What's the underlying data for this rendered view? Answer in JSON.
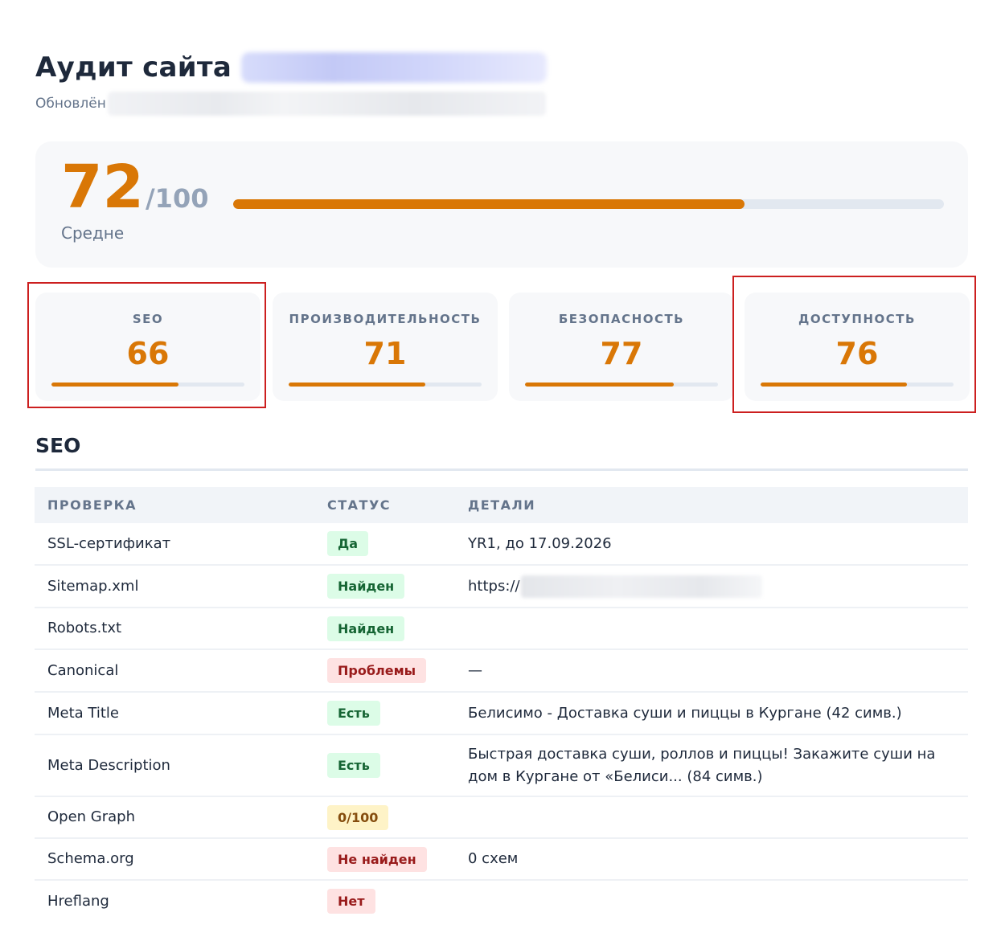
{
  "header": {
    "title": "Аудит сайта",
    "updated_label": "Обновлён"
  },
  "overall": {
    "score": "72",
    "max": "/100",
    "level": "Средне",
    "fraction": 0.72
  },
  "categories": [
    {
      "label": "SEO",
      "value": "66",
      "fraction": 0.66
    },
    {
      "label": "ПРОИЗВОДИТЕЛЬНОСТЬ",
      "value": "71",
      "fraction": 0.71
    },
    {
      "label": "БЕЗОПАСНОСТЬ",
      "value": "77",
      "fraction": 0.77
    },
    {
      "label": "ДОСТУПНОСТЬ",
      "value": "76",
      "fraction": 0.76
    }
  ],
  "seo": {
    "title": "SEO",
    "columns": [
      "ПРОВЕРКА",
      "СТАТУС",
      "ДЕТАЛИ"
    ],
    "rows": [
      {
        "check": "SSL-сертификат",
        "status": "Да",
        "tone": "green",
        "details": "YR1, до 17.09.2026"
      },
      {
        "check": "Sitemap.xml",
        "status": "Найден",
        "tone": "green",
        "details": "https://"
      },
      {
        "check": "Robots.txt",
        "status": "Найден",
        "tone": "green",
        "details": ""
      },
      {
        "check": "Canonical",
        "status": "Проблемы",
        "tone": "red",
        "details": "—"
      },
      {
        "check": "Meta Title",
        "status": "Есть",
        "tone": "green",
        "details": "Белисимо - Доставка суши и пиццы в Кургане (42 симв.)"
      },
      {
        "check": "Meta Description",
        "status": "Есть",
        "tone": "green",
        "details": "Быстрая доставка суши, роллов и пиццы! Закажите суши на дом в Кургане от «Белиси... (84 симв.)"
      },
      {
        "check": "Open Graph",
        "status": "0/100",
        "tone": "yellow",
        "details": ""
      },
      {
        "check": "Schema.org",
        "status": "Не найден",
        "tone": "red",
        "details": "0 схем"
      },
      {
        "check": "Hreflang",
        "status": "Нет",
        "tone": "red",
        "details": ""
      }
    ]
  },
  "colors": {
    "accent": "#d97706",
    "highlight": "#cc1f1f",
    "ok": "#166534",
    "bad": "#991b1b",
    "warn": "#854d0e"
  }
}
